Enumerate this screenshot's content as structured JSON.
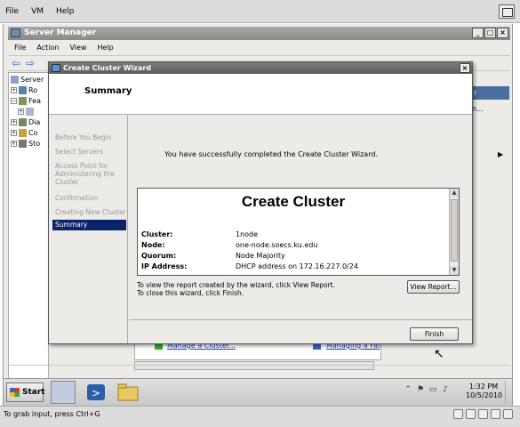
{
  "vm": {
    "menu": [
      "File",
      "VM",
      "Help"
    ],
    "status_text": "To grab input, press Ctrl+G"
  },
  "server_manager": {
    "title": "Server Manager",
    "menu": [
      "File",
      "Action",
      "View",
      "Help"
    ],
    "tree": [
      {
        "label": "Server"
      },
      {
        "label": "Ro"
      },
      {
        "label": "Fea"
      },
      {
        "label": ""
      },
      {
        "label": "Dia"
      },
      {
        "label": "Co"
      },
      {
        "label": "Sto"
      }
    ],
    "actions_header": "r",
    "actions_item": "n...",
    "links": [
      "Manage a Cluster...",
      "Managing a Fai"
    ]
  },
  "wizard": {
    "title": "Create Cluster Wizard",
    "header": "Summary",
    "steps": [
      {
        "label": "Before You Begin",
        "selected": false
      },
      {
        "label": "Select Servers",
        "selected": false
      },
      {
        "label": "Access Point for Administering the Cluster",
        "selected": false
      },
      {
        "label": "Confirmation",
        "selected": false
      },
      {
        "label": "Creating New Cluster",
        "selected": false
      },
      {
        "label": "Summary",
        "selected": true
      }
    ],
    "message": "You have successfully completed the Create Cluster Wizard.",
    "report": {
      "title": "Create Cluster",
      "rows": [
        {
          "key": "Cluster:",
          "value": "1node"
        },
        {
          "key": "Node:",
          "value": "one-node.soecs.ku.edu"
        },
        {
          "key": "Quorum:",
          "value": "Node Majority"
        },
        {
          "key": "IP Address:",
          "value": "DHCP address on 172.16.227.0/24"
        }
      ]
    },
    "instructions": [
      "To view the report created by the wizard, click View Report.",
      "To close this wizard, click Finish."
    ],
    "view_report_label": "View Report...",
    "finish_label": "Finish"
  },
  "taskbar": {
    "start_label": "Start",
    "time": "1:32 PM",
    "date": "10/5/2010"
  }
}
